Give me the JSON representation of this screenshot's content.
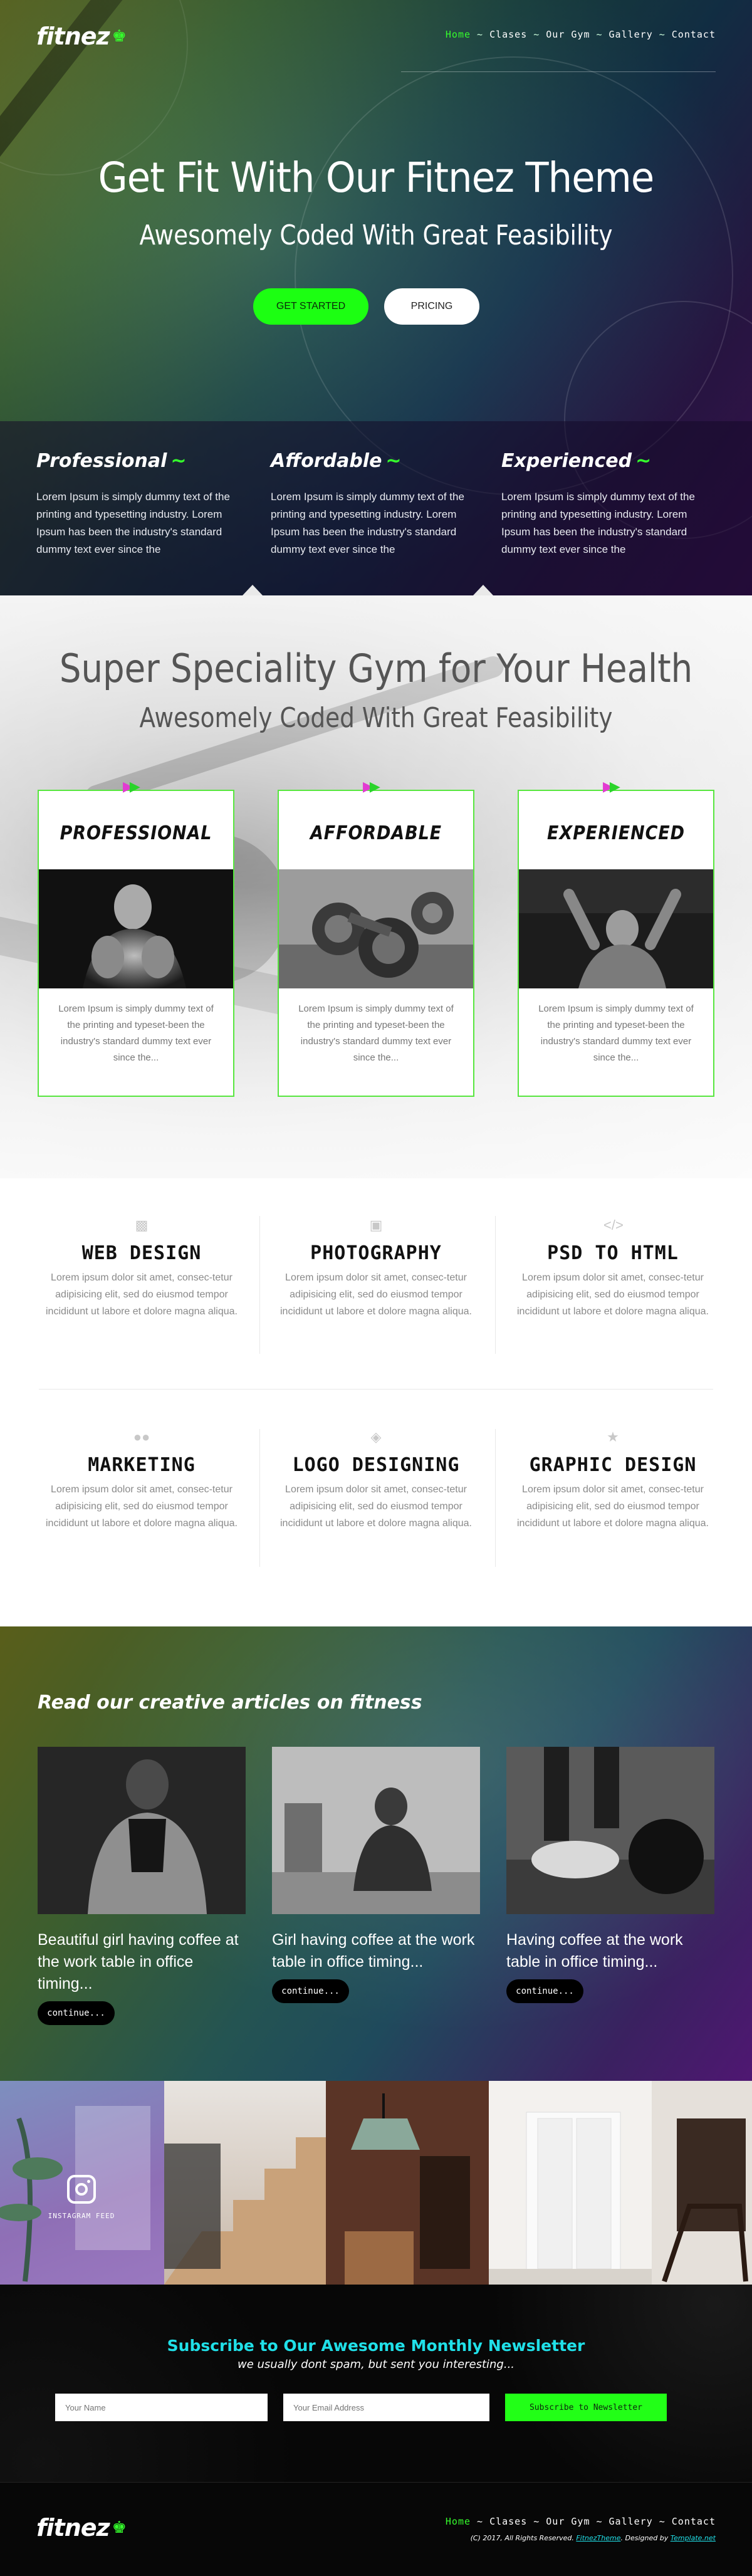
{
  "brand": {
    "logo_text": "fitnez",
    "accent": "#35ff2c",
    "cyan": "#20e0e8"
  },
  "nav": {
    "items": [
      "Home",
      "Clases",
      "Our Gym",
      "Gallery",
      "Contact"
    ],
    "active": "Home",
    "separator": "~"
  },
  "hero": {
    "title": "Get Fit With Our Fitnez Theme",
    "subtitle": "Awesomely Coded With Great Feasibility",
    "primary_button": "GET STARTED",
    "secondary_button": "PRICING",
    "features": [
      {
        "title": "Professional",
        "tilde": "~",
        "text": "Lorem Ipsum is simply dummy text of the printing and typesetting industry. Lorem Ipsum has been the industry's standard dummy text ever since the"
      },
      {
        "title": "Affordable",
        "tilde": "~",
        "text": "Lorem Ipsum is simply dummy text of the printing and typesetting industry. Lorem Ipsum has been the industry's standard dummy text ever since the"
      },
      {
        "title": "Experienced",
        "tilde": "~",
        "text": "Lorem Ipsum is simply dummy text of the printing and typesetting industry. Lorem Ipsum has been the industry's standard dummy text ever since the"
      }
    ]
  },
  "speciality": {
    "title": "Super Speciality Gym for Your Health",
    "subtitle": "Awesomely Coded With Great Feasibility",
    "cards": [
      {
        "title": "PROFESSIONAL",
        "text": "Lorem Ipsum is simply dummy text of the printing and typeset-been the industry's standard dummy text ever since the..."
      },
      {
        "title": "AFFORDABLE",
        "text": "Lorem Ipsum is simply dummy text of the printing and typeset-been the industry's standard dummy text ever since the..."
      },
      {
        "title": "EXPERIENCED",
        "text": "Lorem Ipsum is simply dummy text of the printing and typeset-been the industry's standard dummy text ever since the..."
      }
    ]
  },
  "services": [
    {
      "icon": "monitor-icon",
      "title": "WEB DESIGN",
      "text": "Lorem ipsum dolor sit amet, consec-tetur adipisicing elit, sed do eiusmod tempor incididunt ut labore et dolore magna aliqua."
    },
    {
      "icon": "camera-icon",
      "title": "PHOTOGRAPHY",
      "text": "Lorem ipsum dolor sit amet, consec-tetur adipisicing elit, sed do eiusmod tempor incididunt ut labore et dolore magna aliqua."
    },
    {
      "icon": "code-icon",
      "title": "PSD TO HTML",
      "text": "Lorem ipsum dolor sit amet, consec-tetur adipisicing elit, sed do eiusmod tempor incididunt ut labore et dolore magna aliqua."
    },
    {
      "icon": "users-icon",
      "title": "MARKETING",
      "text": "Lorem ipsum dolor sit amet, consec-tetur adipisicing elit, sed do eiusmod tempor incididunt ut labore et dolore magna aliqua."
    },
    {
      "icon": "tags-icon",
      "title": "LOGO DESIGNING",
      "text": "Lorem ipsum dolor sit amet, consec-tetur adipisicing elit, sed do eiusmod tempor incididunt ut labore et dolore magna aliqua."
    },
    {
      "icon": "trophy-icon",
      "title": "GRAPHIC DESIGN",
      "text": "Lorem ipsum dolor sit amet, consec-tetur adipisicing elit, sed do eiusmod tempor incididunt ut labore et dolore magna aliqua."
    }
  ],
  "articles": {
    "heading": "Read our creative articles on fitness",
    "items": [
      {
        "text": "Beautiful girl having coffee at the work table in office timing...",
        "button": "continue..."
      },
      {
        "text": "Girl having coffee at the work table in office timing...",
        "button": "continue..."
      },
      {
        "text": "Having coffee at the work table in office timing...",
        "button": "continue..."
      }
    ]
  },
  "gallery": {
    "instagram_label": "INSTAGRAM FEED"
  },
  "newsletter": {
    "title": "Subscribe to Our Awesome Monthly Newsletter",
    "subtitle": "we usually dont spam, but sent you interesting...",
    "name_placeholder": "Your Name",
    "email_placeholder": "Your Email Address",
    "button": "Subscribe to Newsletter"
  },
  "footer": {
    "copyright_prefix": "(C) 2017, All Rights Reserved.",
    "brand_link": "FitnezTheme",
    "designed_by": ". Designed by",
    "designer_link": "Template.net"
  }
}
